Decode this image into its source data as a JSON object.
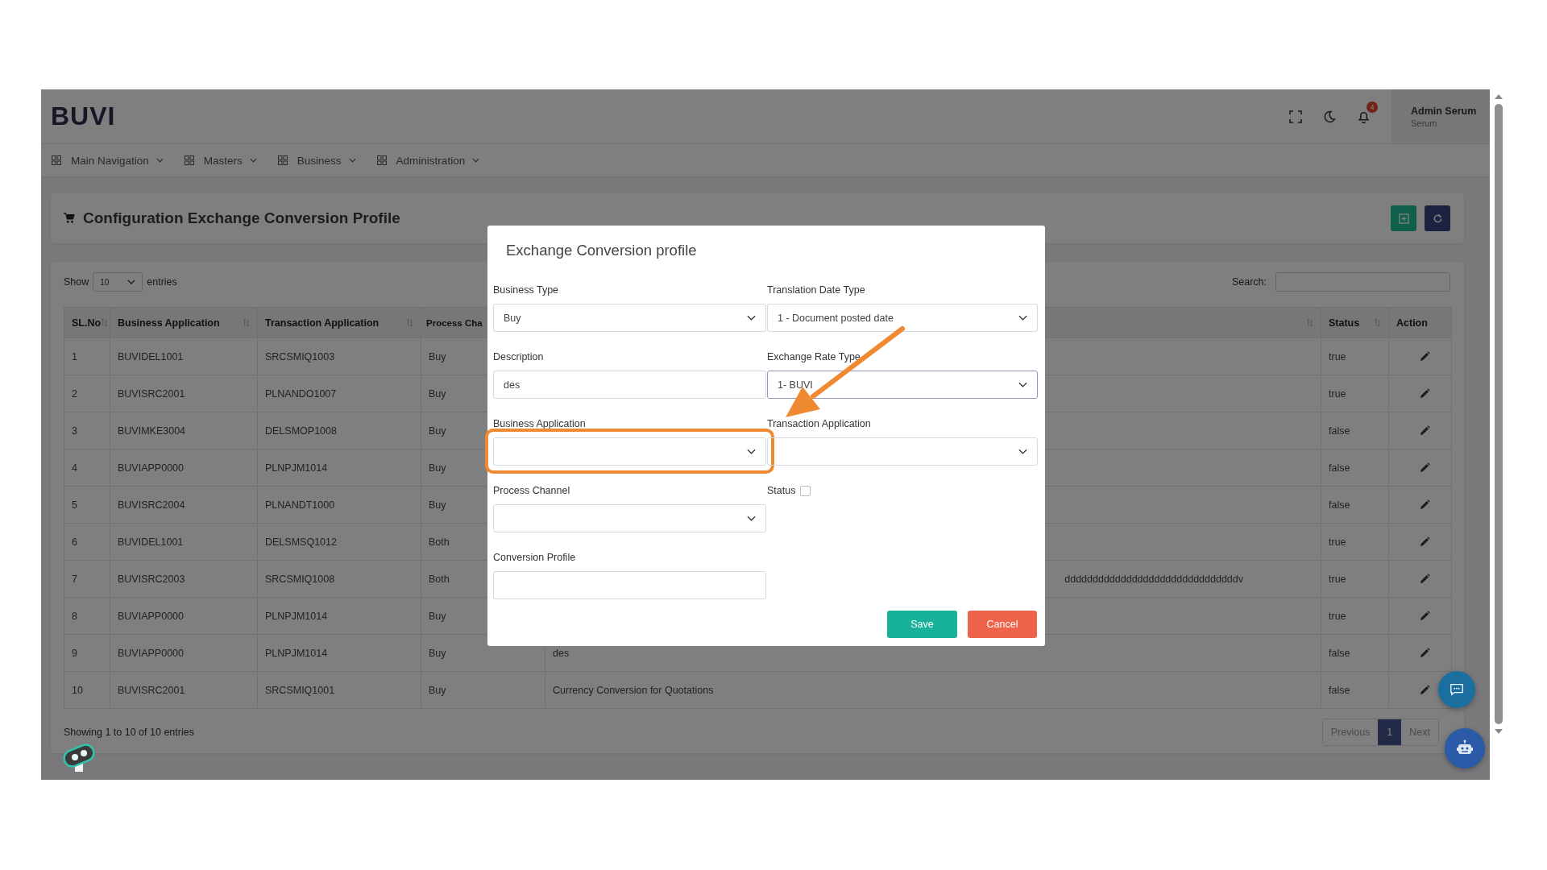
{
  "header": {
    "logo": "BUVI",
    "notification_count": "4",
    "user_name": "Admin Serum",
    "user_role": "Serum"
  },
  "nav": [
    {
      "label": "Main Navigation"
    },
    {
      "label": "Masters"
    },
    {
      "label": "Business"
    },
    {
      "label": "Administration"
    }
  ],
  "page_title": "Configuration Exchange Conversion Profile",
  "table_controls": {
    "show_label": "Show",
    "page_size": "10",
    "entries_label": "entries",
    "search_label": "Search:"
  },
  "table": {
    "columns": [
      {
        "label": "SL.No",
        "sortable": true
      },
      {
        "label": "Business Application",
        "sortable": true
      },
      {
        "label": "Transaction Application",
        "sortable": true
      },
      {
        "label": "Process Cha",
        "sortable": false
      },
      {
        "sortable": true
      },
      {
        "label": "Status",
        "sortable": true
      },
      {
        "label": "Action",
        "sortable": false
      }
    ],
    "rows": [
      {
        "sl": "1",
        "business_application": "BUVIDEL1001",
        "transaction_application": "SRCSMIQ1003",
        "process_channel": "Buy",
        "status": "true"
      },
      {
        "sl": "2",
        "business_application": "BUVISRC2001",
        "transaction_application": "PLNANDO1007",
        "process_channel": "Buy",
        "status": "true"
      },
      {
        "sl": "3",
        "business_application": "BUVIMKE3004",
        "transaction_application": "DELSMOP1008",
        "process_channel": "Buy",
        "status": "false"
      },
      {
        "sl": "4",
        "business_application": "BUVIAPP0000",
        "transaction_application": "PLNPJM1014",
        "process_channel": "Buy",
        "status": "false"
      },
      {
        "sl": "5",
        "business_application": "BUVISRC2004",
        "transaction_application": "PLNANDT1000",
        "process_channel": "Buy",
        "status": "false"
      },
      {
        "sl": "6",
        "business_application": "BUVIDEL1001",
        "transaction_application": "DELSMSQ1012",
        "process_channel": "Both",
        "status": "true"
      },
      {
        "sl": "7",
        "business_application": "BUVISRC2003",
        "transaction_application": "SRCSMIQ1008",
        "process_channel": "Both",
        "description": "dddddddddddddddddddddddddddddddv",
        "description_cut": true,
        "status": "true"
      },
      {
        "sl": "8",
        "business_application": "BUVIAPP0000",
        "transaction_application": "PLNPJM1014",
        "process_channel": "Buy",
        "status": "true"
      },
      {
        "sl": "9",
        "business_application": "BUVIAPP0000",
        "transaction_application": "PLNPJM1014",
        "process_channel": "Buy",
        "description": "des",
        "description_cut": false,
        "status": "false"
      },
      {
        "sl": "10",
        "business_application": "BUVISRC2001",
        "transaction_application": "SRCSMIQ1001",
        "process_channel": "Buy",
        "description": "Currency Conversion for Quotations",
        "description_cut": false,
        "status": "false"
      }
    ]
  },
  "footer": {
    "info": "Showing 1 to 10 of 10 entries",
    "pagination": [
      {
        "label": "Previous",
        "selected": false
      },
      {
        "label": "1",
        "selected": true
      },
      {
        "label": "Next",
        "selected": false
      }
    ]
  },
  "modal": {
    "title": "Exchange Conversion profile",
    "fields": [
      {
        "kind": "select",
        "label": "Business Type",
        "value": "Buy",
        "focused": false,
        "highlighted": false
      },
      {
        "kind": "select",
        "label": "Translation Date Type",
        "value": "1 - Document posted date",
        "focused": false,
        "highlighted": false
      },
      {
        "kind": "text",
        "label": "Description",
        "value": "des",
        "focused": false,
        "highlighted": false
      },
      {
        "kind": "select",
        "label": "Exchange Rate Type",
        "value": "1- BUVI",
        "focused": true,
        "highlighted": false
      },
      {
        "kind": "select",
        "label": "Business Application",
        "focused": false,
        "highlighted": true
      },
      {
        "kind": "select",
        "label": "Transaction Application",
        "focused": false,
        "highlighted": false
      },
      {
        "kind": "select",
        "label": "Process Channel",
        "focused": false,
        "highlighted": false
      },
      {
        "kind": "checkbox",
        "label": "Status",
        "checked": false
      },
      {
        "kind": "text",
        "label": "Conversion Profile",
        "focused": false,
        "highlighted": false
      }
    ],
    "buttons": [
      {
        "label": "Save",
        "kind": "primary"
      },
      {
        "label": "Cancel",
        "kind": "danger"
      }
    ]
  }
}
